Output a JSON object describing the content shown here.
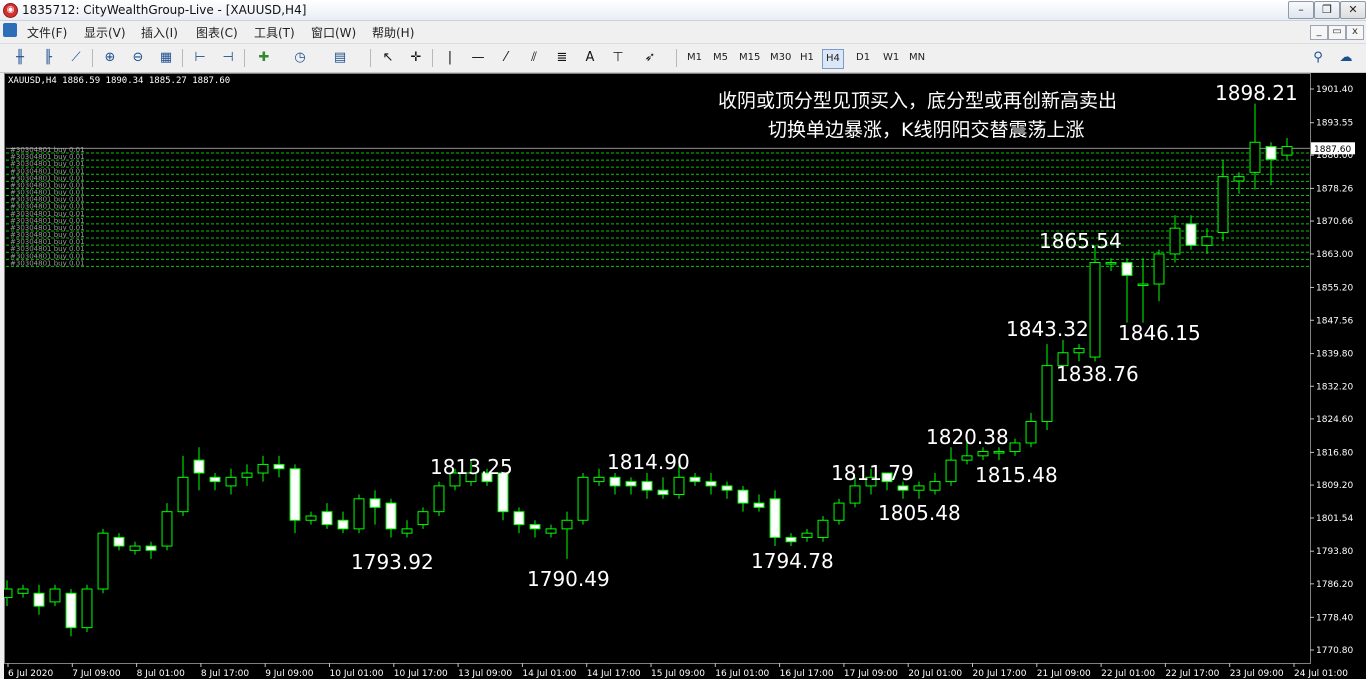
{
  "window": {
    "title": "1835712: CityWealthGroup-Live - [XAUUSD,H4]",
    "app_icon": "mt4-logo-icon"
  },
  "menu": [
    "文件(F)",
    "显示(V)",
    "插入(I)",
    "图表(C)",
    "工具(T)",
    "窗口(W)",
    "帮助(H)"
  ],
  "toolbar": {
    "timeframes": [
      "M1",
      "M5",
      "M15",
      "M30",
      "H1",
      "H4",
      "D1",
      "W1",
      "MN"
    ],
    "active_timeframe": "H4",
    "text_tool": "A"
  },
  "chart": {
    "info_line": "XAUUSD,H4  1886.59 1890.34 1885.27 1887.60",
    "headline_1": "收阴或顶分型见顶买入，底分型或再创新高卖出",
    "headline_2": "切换单边暴涨，K线阴阳交替震荡上涨",
    "current_price": "1887.60",
    "colors": {
      "bull": "#00ff00",
      "bear_fill": "#ffffff",
      "background": "#000000",
      "order_line": "#00c800"
    }
  },
  "chart_data": {
    "type": "candlestick",
    "symbol": "XAUUSD",
    "timeframe": "H4",
    "ylim": [
      1770.8,
      1901.4
    ],
    "y_ticks": [
      "1901.40",
      "1893.55",
      "1886.00",
      "1878.26",
      "1870.66",
      "1863.00",
      "1855.20",
      "1847.56",
      "1839.80",
      "1832.20",
      "1824.60",
      "1816.80",
      "1809.20",
      "1801.54",
      "1793.80",
      "1786.20",
      "1778.40",
      "1770.80"
    ],
    "x_ticks": [
      "6 Jul 2020",
      "7 Jul 09:00",
      "8 Jul 01:00",
      "8 Jul 17:00",
      "9 Jul 09:00",
      "10 Jul 01:00",
      "10 Jul 17:00",
      "13 Jul 09:00",
      "14 Jul 01:00",
      "14 Jul 17:00",
      "15 Jul 09:00",
      "16 Jul 01:00",
      "16 Jul 17:00",
      "17 Jul 09:00",
      "20 Jul 01:00",
      "20 Jul 17:00",
      "21 Jul 09:00",
      "22 Jul 01:00",
      "22 Jul 17:00",
      "23 Jul 09:00",
      "24 Jul 01:00"
    ],
    "annotations": [
      {
        "text": "1898.21",
        "price": 1898.21
      },
      {
        "text": "1865.54",
        "price": 1865.54
      },
      {
        "text": "1846.15",
        "price": 1846.15
      },
      {
        "text": "1843.32",
        "price": 1843.32
      },
      {
        "text": "1838.76",
        "price": 1838.76
      },
      {
        "text": "1820.38",
        "price": 1820.38
      },
      {
        "text": "1815.48",
        "price": 1815.48
      },
      {
        "text": "1814.90",
        "price": 1814.9
      },
      {
        "text": "1813.25",
        "price": 1813.25
      },
      {
        "text": "1811.79",
        "price": 1811.79
      },
      {
        "text": "1805.48",
        "price": 1805.48
      },
      {
        "text": "1794.78",
        "price": 1794.78
      },
      {
        "text": "1793.92",
        "price": 1793.92
      },
      {
        "text": "1790.49",
        "price": 1790.49
      }
    ],
    "pending_orders_label": "#30304801 buy 0.01",
    "candles": [
      [
        1783,
        1785,
        1781,
        1787
      ],
      [
        1784,
        1785,
        1783,
        1786
      ],
      [
        1784,
        1781,
        1779,
        1786
      ],
      [
        1782,
        1785,
        1781,
        1786
      ],
      [
        1784,
        1776,
        1774,
        1785
      ],
      [
        1776,
        1785,
        1775,
        1786
      ],
      [
        1785,
        1798,
        1784,
        1799
      ],
      [
        1797,
        1795,
        1794,
        1798
      ],
      [
        1794,
        1795,
        1793,
        1796
      ],
      [
        1795,
        1794,
        1792,
        1796
      ],
      [
        1795,
        1803,
        1794,
        1805
      ],
      [
        1803,
        1811,
        1802,
        1816
      ],
      [
        1815,
        1812,
        1808,
        1818
      ],
      [
        1811,
        1810,
        1808,
        1812
      ],
      [
        1809,
        1811,
        1807,
        1813
      ],
      [
        1811,
        1812,
        1809,
        1814
      ],
      [
        1812,
        1814,
        1810,
        1816
      ],
      [
        1814,
        1813,
        1811,
        1816
      ],
      [
        1813,
        1801,
        1798,
        1814
      ],
      [
        1801,
        1802,
        1800,
        1803
      ],
      [
        1803,
        1800,
        1799,
        1805
      ],
      [
        1801,
        1799,
        1798,
        1803
      ],
      [
        1799,
        1806,
        1798,
        1807
      ],
      [
        1806,
        1804,
        1800,
        1808
      ],
      [
        1805,
        1799,
        1797,
        1806
      ],
      [
        1798,
        1799,
        1797,
        1801
      ],
      [
        1800,
        1803,
        1799,
        1804
      ],
      [
        1803,
        1809,
        1802,
        1810
      ],
      [
        1809,
        1812,
        1808,
        1813
      ],
      [
        1810,
        1812,
        1809,
        1815
      ],
      [
        1812,
        1810,
        1809,
        1813
      ],
      [
        1812,
        1803,
        1801,
        1812
      ],
      [
        1803,
        1800,
        1798,
        1804
      ],
      [
        1800,
        1799,
        1797,
        1801
      ],
      [
        1798,
        1799,
        1797,
        1800
      ],
      [
        1799,
        1801,
        1792,
        1803
      ],
      [
        1801,
        1811,
        1800,
        1812
      ],
      [
        1810,
        1811,
        1809,
        1813
      ],
      [
        1811,
        1809,
        1807,
        1812
      ],
      [
        1810,
        1809,
        1807,
        1811
      ],
      [
        1810,
        1808,
        1806,
        1812
      ],
      [
        1808,
        1807,
        1806,
        1811
      ],
      [
        1807,
        1811,
        1806,
        1815
      ],
      [
        1811,
        1810,
        1809,
        1812
      ],
      [
        1810,
        1809,
        1807,
        1812
      ],
      [
        1809,
        1808,
        1806,
        1810
      ],
      [
        1808,
        1805,
        1803,
        1809
      ],
      [
        1805,
        1804,
        1803,
        1807
      ],
      [
        1806,
        1797,
        1795,
        1808
      ],
      [
        1797,
        1796,
        1795,
        1798
      ],
      [
        1797,
        1798,
        1796,
        1799
      ],
      [
        1797,
        1801,
        1796,
        1802
      ],
      [
        1801,
        1805,
        1800,
        1806
      ],
      [
        1805,
        1809,
        1804,
        1811
      ],
      [
        1809,
        1811,
        1807,
        1813
      ],
      [
        1812,
        1810,
        1808,
        1812
      ],
      [
        1809,
        1808,
        1806,
        1810
      ],
      [
        1808,
        1809,
        1806,
        1810
      ],
      [
        1808,
        1810,
        1807,
        1812
      ],
      [
        1810,
        1815,
        1809,
        1818
      ],
      [
        1815,
        1816,
        1814,
        1820
      ],
      [
        1816,
        1817,
        1815,
        1818
      ],
      [
        1817,
        1817,
        1815,
        1818
      ],
      [
        1817,
        1819,
        1816,
        1820
      ],
      [
        1819,
        1824,
        1818,
        1826
      ],
      [
        1824,
        1837,
        1822,
        1842
      ],
      [
        1837,
        1840,
        1836,
        1843
      ],
      [
        1840,
        1841,
        1838,
        1842
      ],
      [
        1839,
        1861,
        1838,
        1865
      ],
      [
        1861,
        1861,
        1859,
        1862
      ],
      [
        1861,
        1858,
        1847,
        1862
      ],
      [
        1856,
        1856,
        1847,
        1862
      ],
      [
        1856,
        1863,
        1852,
        1864
      ],
      [
        1863,
        1869,
        1861,
        1872
      ],
      [
        1870,
        1865,
        1864,
        1872
      ],
      [
        1865,
        1867,
        1863,
        1869
      ],
      [
        1868,
        1881,
        1866,
        1885
      ],
      [
        1880,
        1881,
        1877,
        1882
      ],
      [
        1882,
        1889,
        1878,
        1898
      ],
      [
        1888,
        1885,
        1879,
        1889
      ],
      [
        1886,
        1888,
        1885,
        1890
      ]
    ]
  }
}
